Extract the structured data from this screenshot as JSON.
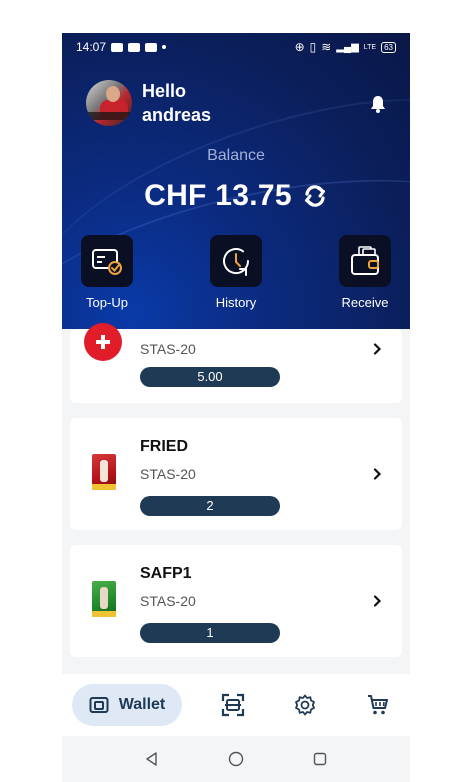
{
  "status_bar": {
    "time": "14:07",
    "battery": "63",
    "network": "LTE"
  },
  "header": {
    "greeting_line1": "Hello",
    "greeting_line2": "andreas",
    "balance_label": "Balance",
    "balance_value": "CHF 13.75"
  },
  "actions": [
    {
      "label": "Top-Up",
      "icon": "topup-card-icon"
    },
    {
      "label": "History",
      "icon": "history-clock-icon"
    },
    {
      "label": "Receive",
      "icon": "receive-wallet-icon"
    }
  ],
  "tokens": [
    {
      "name": "",
      "standard": "STAS-20",
      "amount": "5.00",
      "icon": "swiss-flag-icon"
    },
    {
      "name": "FRIED",
      "standard": "STAS-20",
      "amount": "2",
      "icon": "player-card-icon"
    },
    {
      "name": "SAFP1",
      "standard": "STAS-20",
      "amount": "1",
      "icon": "player-card-icon"
    }
  ],
  "bottom_nav": {
    "wallet_label": "Wallet"
  },
  "colors": {
    "header_bg": "#0b1f5c",
    "pill_bg": "#1f3a55",
    "wallet_tab_bg": "#dfe9f5",
    "flag_red": "#e11d2a"
  }
}
